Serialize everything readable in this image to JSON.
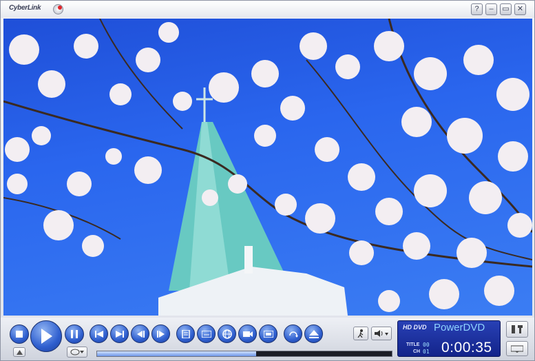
{
  "window": {
    "brand": "CyberLink",
    "help_glyph": "?",
    "minimize_glyph": "–",
    "maximize_glyph": "▭",
    "close_glyph": "✕"
  },
  "player": {
    "hd_label": "HD DVD",
    "product": "PowerDVD",
    "title_label": "TITLE",
    "chapter_label": "CH",
    "title_number": "00",
    "chapter_number": "01",
    "time": "0:00:35",
    "seek_fraction": 0.54
  },
  "controls": {
    "buttons": [
      "stop",
      "play",
      "pause",
      "previous",
      "next",
      "step-backward",
      "step-forward",
      "menu",
      "subtitle",
      "angle",
      "capture",
      "options",
      "repeat",
      "quick-access"
    ]
  },
  "colors": {
    "accent": "#2f5fcf",
    "lcd_background": "#1a2d9e",
    "sky": "#2a66ee"
  }
}
